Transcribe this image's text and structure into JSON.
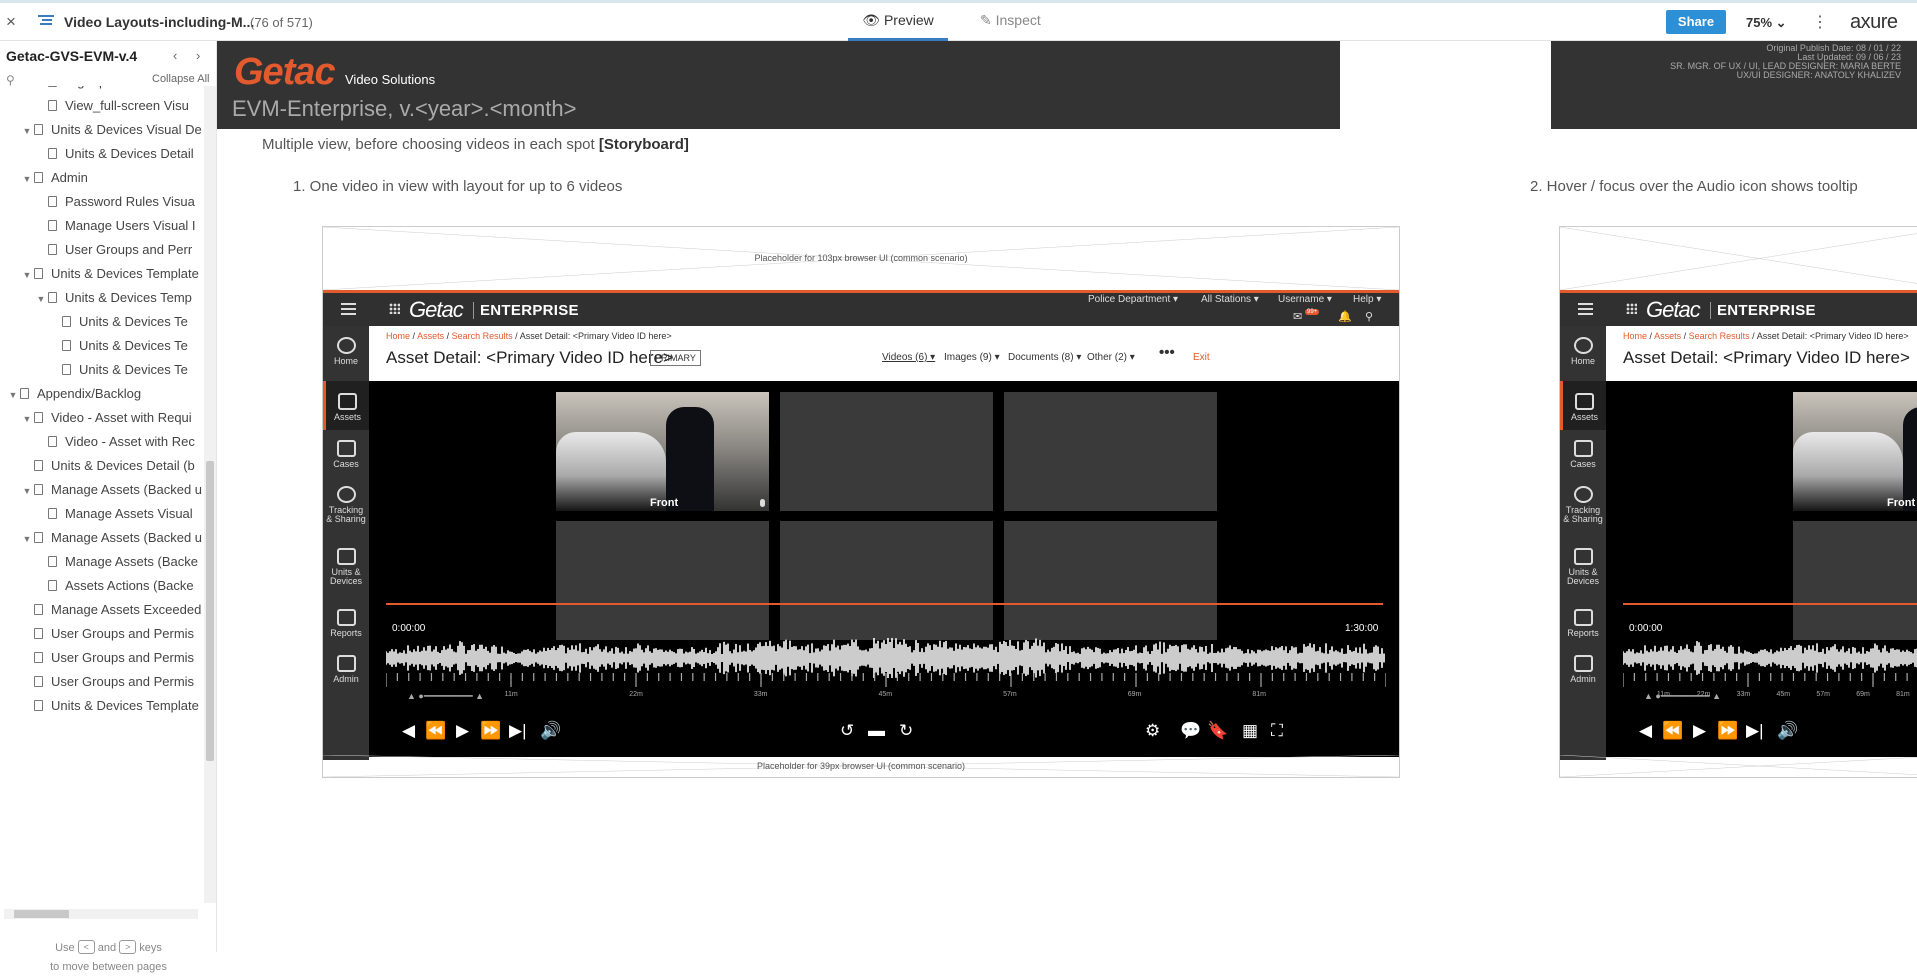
{
  "topbar": {
    "close": "×",
    "doc_title": "Video Layouts-including-M...",
    "page_count": "(76 of 571)",
    "preview": "Preview",
    "inspect": "Inspect",
    "share": "Share",
    "zoom": "75%",
    "kebab": "⋮",
    "brand": "axure"
  },
  "sidebar": {
    "project": "Getac-GVS-EVM-v.4",
    "prev": "‹",
    "next": "›",
    "collapse_all": "Collapse All",
    "tree": [
      {
        "label": "Right panel notes and",
        "indent": 3,
        "tw": ""
      },
      {
        "label": "View_full-screen Visu",
        "indent": 3,
        "tw": ""
      },
      {
        "label": "Units & Devices Visual De",
        "indent": 2,
        "tw": "▼"
      },
      {
        "label": "Units & Devices Detail",
        "indent": 3,
        "tw": ""
      },
      {
        "label": "Admin",
        "indent": 2,
        "tw": "▼"
      },
      {
        "label": "Password Rules Visua",
        "indent": 3,
        "tw": ""
      },
      {
        "label": "Manage Users Visual I",
        "indent": 3,
        "tw": ""
      },
      {
        "label": "User Groups and Perr",
        "indent": 3,
        "tw": ""
      },
      {
        "label": "Units & Devices Template",
        "indent": 2,
        "tw": "▼"
      },
      {
        "label": "Units & Devices Temp",
        "indent": 3,
        "tw": "▼"
      },
      {
        "label": "Units & Devices Te",
        "indent": 4,
        "tw": ""
      },
      {
        "label": "Units & Devices Te",
        "indent": 4,
        "tw": ""
      },
      {
        "label": "Units & Devices Te",
        "indent": 4,
        "tw": ""
      },
      {
        "label": "Appendix/Backlog",
        "indent": 1,
        "tw": "▼"
      },
      {
        "label": "Video - Asset with Requi",
        "indent": 2,
        "tw": "▼"
      },
      {
        "label": "Video - Asset with Rec",
        "indent": 3,
        "tw": ""
      },
      {
        "label": "Units & Devices Detail (b",
        "indent": 2,
        "tw": ""
      },
      {
        "label": "Manage Assets (Backed u",
        "indent": 2,
        "tw": "▼"
      },
      {
        "label": "Manage Assets Visual",
        "indent": 3,
        "tw": ""
      },
      {
        "label": "Manage Assets (Backed u",
        "indent": 2,
        "tw": "▼"
      },
      {
        "label": "Manage Assets (Backe",
        "indent": 3,
        "tw": ""
      },
      {
        "label": "Assets Actions (Backe",
        "indent": 3,
        "tw": ""
      },
      {
        "label": "Manage Assets Exceeded",
        "indent": 2,
        "tw": ""
      },
      {
        "label": "User Groups and Permis",
        "indent": 2,
        "tw": ""
      },
      {
        "label": "User Groups and Permis",
        "indent": 2,
        "tw": ""
      },
      {
        "label": "User Groups and Permis",
        "indent": 2,
        "tw": ""
      },
      {
        "label": "Units & Devices Template",
        "indent": 2,
        "tw": ""
      }
    ],
    "hint_use": "Use",
    "hint_and": "and",
    "hint_keys": "keys",
    "hint_line2": "to move between pages",
    "key_prev": "<",
    "key_next": ">"
  },
  "page": {
    "logo": "Getac",
    "video_solutions": "Video Solutions",
    "product": "EVM-Enterprise,    v.<year>.<month>",
    "publish_info": [
      "Original Publish Date: 08 / 01 / 22",
      "Last Updated: 09 / 06 / 23",
      "SR. MGR. OF UX / UI, LEAD DESIGNER: MARIA BERTE",
      "UX/UI DESIGNER: ANATOLY KHALIZEV"
    ],
    "section_title": "Multiple view, before choosing videos in each spot ",
    "section_title_bold": "[Storyboard]",
    "step1": "1. One video in view with layout for up to 6 videos",
    "step2": "2. Hover / focus over the Audio icon shows tooltip"
  },
  "mock": {
    "placeholder_top": "Placeholder for 103px browser UI (common scenario)",
    "placeholder_bottom": "Placeholder for 39px browser UI (common scenario)",
    "logo": "Getac",
    "enterprise": "ENTERPRISE",
    "user_menu": [
      "Police Department ▾",
      "All Stations ▾",
      "Username ▾",
      "Help ▾"
    ],
    "badge": "99+",
    "rail": [
      {
        "label": "Home"
      },
      {
        "label": "Assets",
        "active": true
      },
      {
        "label": "Cases"
      },
      {
        "label": "Tracking\n& Sharing"
      },
      {
        "label": "Units &\nDevices"
      },
      {
        "label": "Reports"
      },
      {
        "label": "Admin"
      }
    ],
    "breadcrumb": {
      "home": "Home",
      "assets": "Assets",
      "search": "Search Results",
      "sep": "/",
      "current": "Asset Detail: <Primary Video ID here>"
    },
    "asset_title": "Asset Detail: <Primary Video ID here>",
    "primary": "PRIMARY",
    "filters": [
      "Videos (6) ▾",
      "Images (9) ▾",
      "Documents (8) ▾",
      "Other (2) ▾"
    ],
    "more": "•••",
    "exit": "Exit",
    "tile_label": "Front",
    "start_time": "0:00:00",
    "end_time": "1:30:00",
    "tick_labels": [
      "11m",
      "22m",
      "33m",
      "45m",
      "57m",
      "69m",
      "81m"
    ],
    "controls_left": [
      "◀",
      "⏪",
      "▶",
      "⏩",
      "▶|",
      "🔊"
    ],
    "controls_mid": [
      "↺",
      "▬",
      "↻"
    ],
    "controls_right": [
      "⚙",
      "💬",
      "🔖",
      "▦",
      "⛶"
    ],
    "chevron": "⌄"
  }
}
